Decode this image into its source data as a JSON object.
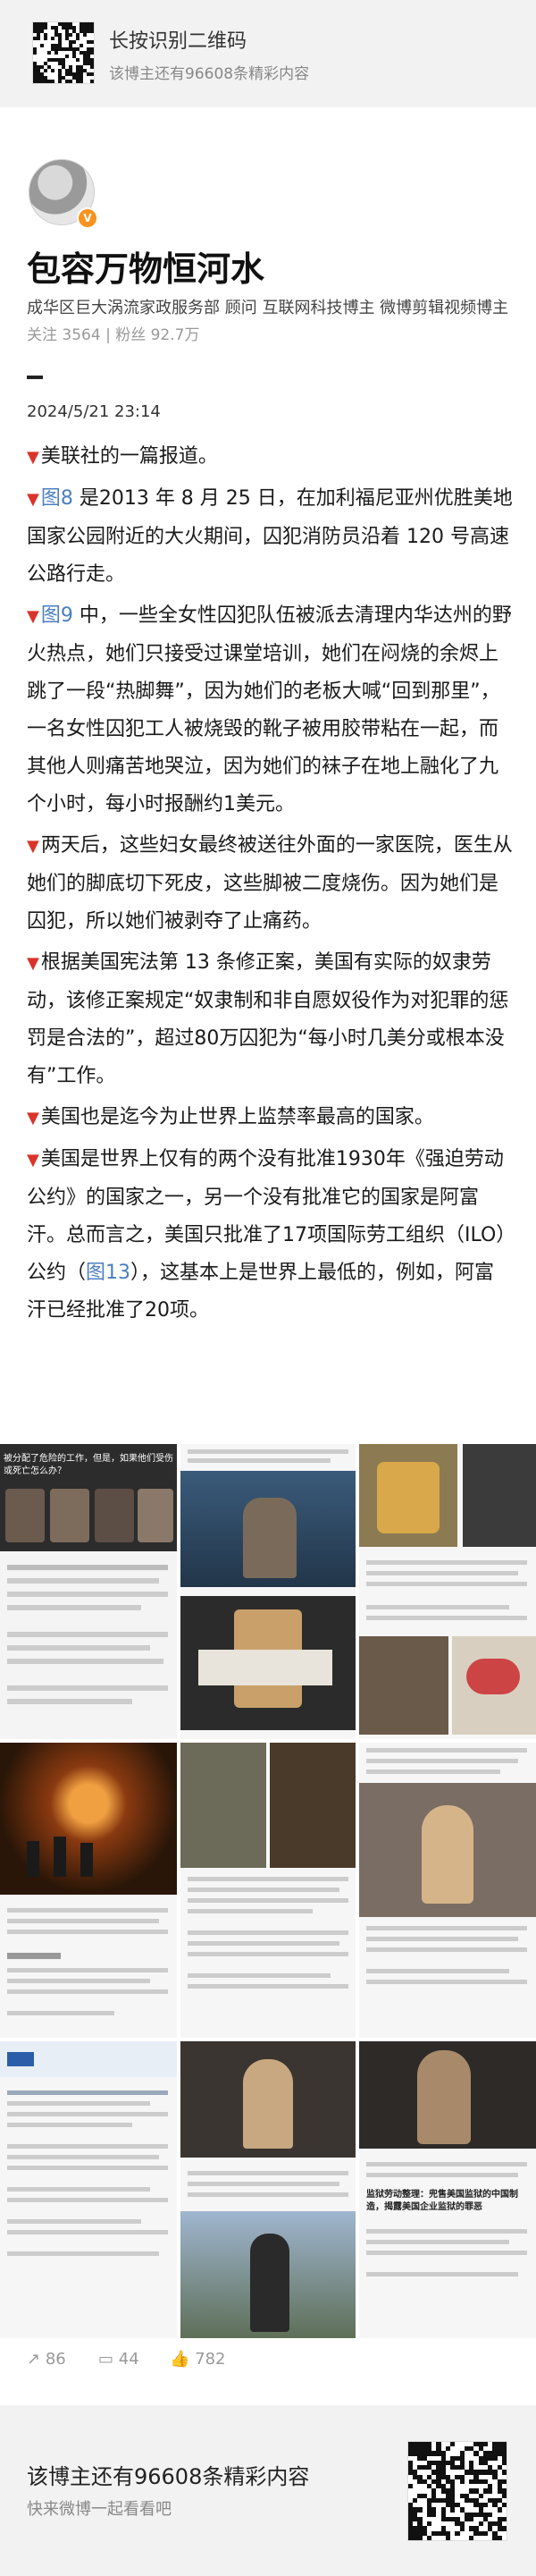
{
  "top_banner": {
    "title": "长按识别二维码",
    "subtitle": "该博主还有96608条精彩内容"
  },
  "profile": {
    "name": "包容万物恒河水",
    "description": "成华区巨大涡流家政服务部 顾问 互联网科技博主 微博剪辑视频博主",
    "stats": "关注 3564 | 粉丝 92.7万"
  },
  "post": {
    "date": "2024/5/21 23:14",
    "paragraphs": [
      {
        "text": "美联社的一篇报道。"
      },
      {
        "link": "图8",
        "text": " 是2013 年 8 月 25 日，在加利福尼亚州优胜美地国家公园附近的大火期间，囚犯消防员沿着 120 号高速公路行走。"
      },
      {
        "link": "图9",
        "text": " 中，一些全女性囚犯队伍被派去清理内华达州的野火热点，她们只接受过课堂培训，她们在闷烧的余烬上跳了一段“热脚舞”，因为她们的老板大喊“回到那里”，一名女性囚犯工人被烧毁的靴子被用胶带粘在一起，而其他人则痛苦地哭泣，因为她们的袜子在地上融化了九个小时，每小时报酬约1美元。"
      },
      {
        "text": "两天后，这些妇女最终被送往外面的一家医院，医生从她们的脚底切下死皮，这些脚被二度烧伤。因为她们是囚犯，所以她们被剥夺了止痛药。"
      },
      {
        "text": "根据美国宪法第 13 条修正案，美国有实际的奴隶劳动，该修正案规定“奴隶制和非自愿奴役作为对犯罪的惩罚是合法的”，超过80万囚犯为“每小时几美分或根本没有”工作。"
      },
      {
        "text": "美国也是迄今为止世界上监禁率最高的国家。"
      },
      {
        "text": "美国是世界上仅有的两个没有批准1930年《强迫劳动公约》的国家之一，另一个没有批准它的国家是阿富汗。总而言之，美国只批准了17项国际劳工组织（ILO）公约（",
        "link_after": "图13",
        "tail": "），这基本上是世界上最低的，例如，阿富汗已经批准了20项。"
      }
    ]
  },
  "images": {
    "img1_caption": "被分配了危险的工作，但是，如果他们受伤或死亡怎么办？",
    "img12_caption": "监狱劳动整理：兜售美国监狱的中国制造，揭露美国企业监狱的罪恶"
  },
  "actions": {
    "repost": "86",
    "comment": "44",
    "like": "782"
  },
  "footer": {
    "title": "该博主还有96608条精彩内容",
    "subtitle": "快来微博一起看看吧"
  },
  "colors": {
    "accent_red": "#d9342b",
    "link_blue": "#4a7ec0"
  }
}
